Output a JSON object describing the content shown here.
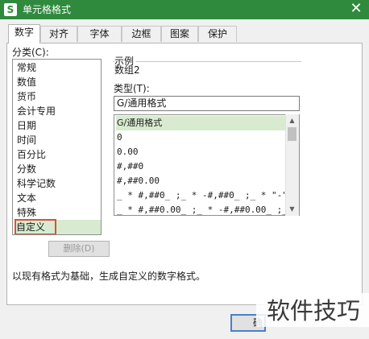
{
  "window": {
    "icon_letter": "S",
    "title": "单元格格式",
    "close": "✕"
  },
  "tabs": [
    {
      "label": "数字",
      "active": true
    },
    {
      "label": "对齐",
      "active": false
    },
    {
      "label": "字体",
      "active": false
    },
    {
      "label": "边框",
      "active": false
    },
    {
      "label": "图案",
      "active": false
    },
    {
      "label": "保护",
      "active": false
    }
  ],
  "category": {
    "label": "分类(C):",
    "items": [
      "常规",
      "数值",
      "货币",
      "会计专用",
      "日期",
      "时间",
      "百分比",
      "分数",
      "科学记数",
      "文本",
      "特殊",
      "自定义"
    ],
    "selected": "自定义"
  },
  "delete_button": "删除(D)",
  "sample": {
    "title": "示例",
    "value": "数组2"
  },
  "type": {
    "label": "类型(T):",
    "input_value": "G/通用格式",
    "items": [
      "G/通用格式",
      "0",
      "0.00",
      "#,##0",
      "#,##0.00",
      "_ * #,##0_ ;_ * -#,##0_ ;_ * \"-\"…",
      "_ * #,##0.00_ ;_ * -#,##0.00_ ;_…"
    ],
    "selected": "G/通用格式"
  },
  "description": "以现有格式为基础，生成自定义的数字格式。",
  "ok_button": "确",
  "watermark": "软件技巧",
  "colors": {
    "titlebar": "#2f8a3e",
    "selection": "#d8ebd0",
    "highlight_box": "#d9503a"
  }
}
